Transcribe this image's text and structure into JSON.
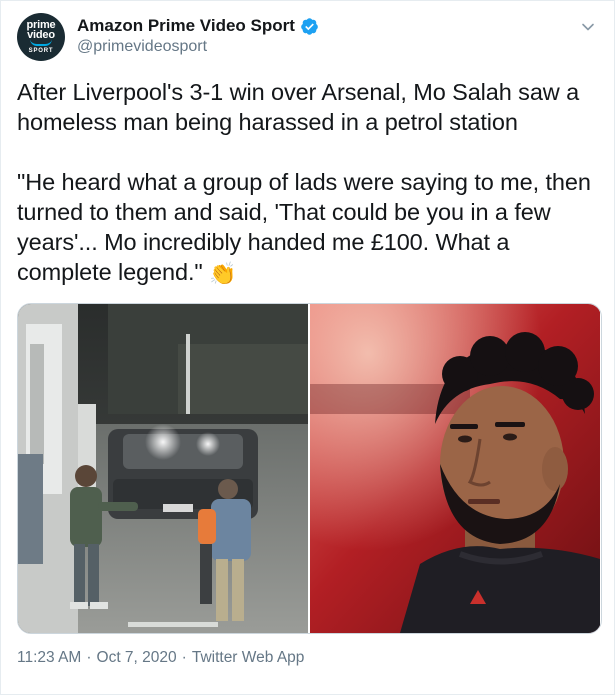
{
  "author": {
    "display_name": "Amazon Prime Video Sport",
    "handle": "@primevideosport",
    "avatar_text": [
      "prime",
      "video",
      "SPORT"
    ],
    "verified": true
  },
  "tweet": {
    "paragraph_1": "After Liverpool's 3-1 win over Arsenal, Mo Salah saw a homeless man being harassed in a petrol station",
    "paragraph_2": "\"He heard what a group of lads were saying to me, then turned to them and said, 'That could be you in a few years'... Mo incredibly handed me £100. What a complete legend.\"",
    "emoji": "👏"
  },
  "media": [
    {
      "icon": "cctv-photo"
    },
    {
      "icon": "player-portrait-photo"
    }
  ],
  "footer": {
    "time": "11:23 AM",
    "date": "Oct 7, 2020",
    "source": "Twitter Web App",
    "separator": "·"
  },
  "colors": {
    "text": "#14171a",
    "secondary": "#657786",
    "verified": "#1da1f2",
    "border": "#e6ecf0"
  }
}
